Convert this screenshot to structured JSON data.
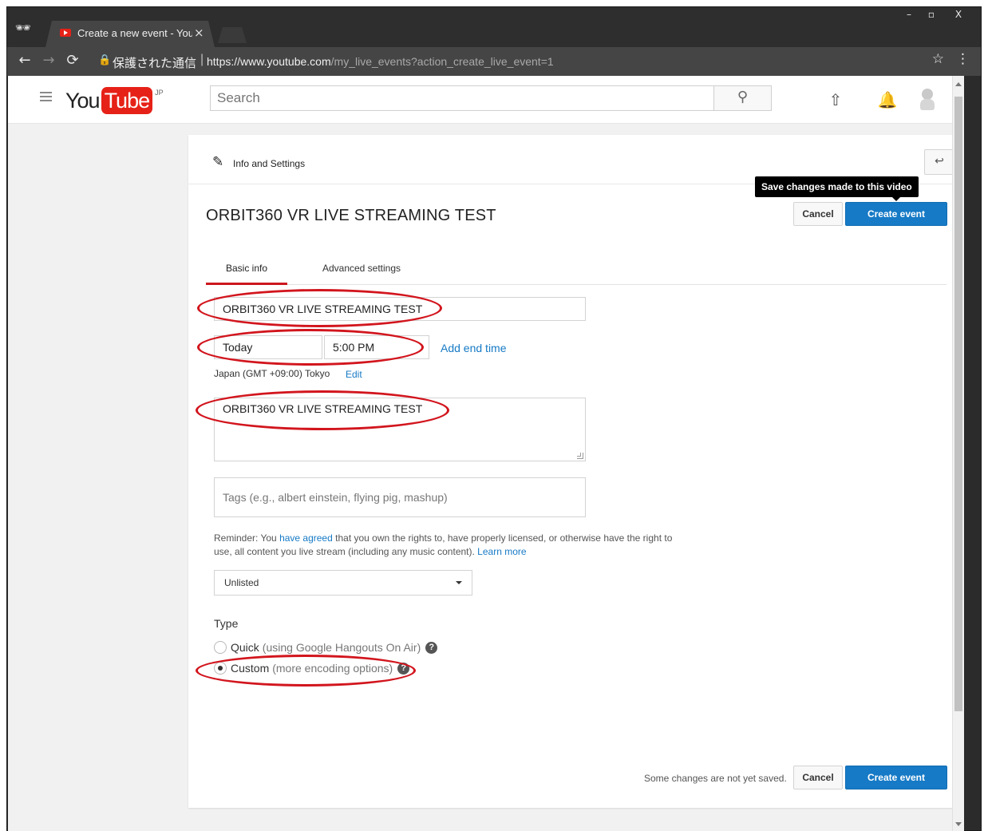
{
  "browser": {
    "tab_title": "Create a new event - YouTube",
    "tab_close": "×",
    "secure_label": "保護された通信",
    "url_host": "https://www.youtube.com",
    "url_path": "/my_live_events?action_create_live_event=1",
    "window_controls": {
      "minimize": "–",
      "maximize": "▫",
      "close": "X"
    }
  },
  "masthead": {
    "logo_you": "You",
    "logo_tube": "Tube",
    "logo_region": "JP",
    "search_placeholder": "Search"
  },
  "header": {
    "title": "Info and Settings",
    "tooltip": "Save changes made to this video"
  },
  "event": {
    "title": "ORBIT360 VR LIVE STREAMING TEST",
    "cancel_label": "Cancel",
    "create_label": "Create event"
  },
  "tabs": [
    {
      "label": "Basic info",
      "active": true
    },
    {
      "label": "Advanced settings",
      "active": false
    }
  ],
  "form": {
    "title_value": "ORBIT360 VR LIVE STREAMING TEST",
    "date_value": "Today",
    "time_value": "5:00 PM",
    "add_end_time": "Add end time",
    "timezone": "Japan (GMT +09:00) Tokyo",
    "timezone_edit": "Edit",
    "description_value": "ORBIT360 VR LIVE STREAMING TEST",
    "tags_placeholder": "Tags (e.g., albert einstein, flying pig, mashup)",
    "reminder_prefix": "Reminder: You ",
    "reminder_link": "have agreed",
    "reminder_body": " that you own the rights to, have properly licensed, or otherwise have the right to use, all content you live stream (including any music content). ",
    "reminder_learn_more": "Learn more",
    "privacy_value": "Unlisted",
    "type_label": "Type",
    "type_options": [
      {
        "label": "Quick",
        "sub": "(using Google Hangouts On Air)",
        "checked": false
      },
      {
        "label": "Custom",
        "sub": "(more encoding options)",
        "checked": true
      }
    ]
  },
  "footer": {
    "unsaved": "Some changes are not yet saved.",
    "cancel_label": "Cancel",
    "create_label": "Create event"
  },
  "colors": {
    "primary": "#167ac6",
    "annotation": "#d2151d",
    "tab_active": "#cc181e"
  }
}
